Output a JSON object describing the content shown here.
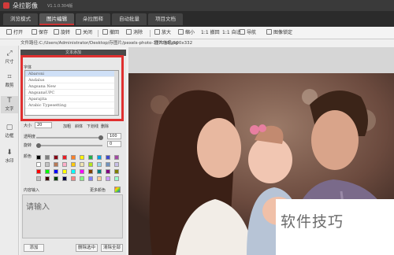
{
  "window": {
    "title": "朵拉影像",
    "version": "V1.1.0.304版"
  },
  "tabs": [
    {
      "label": "浏览模式",
      "active": false
    },
    {
      "label": "图片编辑",
      "active": true
    },
    {
      "label": "朵拉图释",
      "active": false
    },
    {
      "label": "自动批量",
      "active": false
    },
    {
      "label": "项目文档",
      "active": false
    }
  ],
  "toolbar": {
    "open": "打开",
    "save": "保存",
    "rotate": "旋转",
    "close": "关闭",
    "flip": "撤回",
    "redo": "消除",
    "zoom_in": "放大",
    "zoom_out": "缩小",
    "ratio": "1:1 撤回",
    "fit": "1:1 自适",
    "nav": "导航",
    "lock": "图像锁定"
  },
  "path": {
    "label": "文件路径:C:/Users/Administrator/Desktop/存图片/pexels-photo-377058.jpg",
    "size": "图片信息:500x332"
  },
  "left_tools": [
    "尺寸",
    "裁剪",
    "文字",
    "边框",
    "水印"
  ],
  "panel": {
    "header": "文本添加",
    "font_label": "字体",
    "fonts": [
      "Abaroni",
      "Andalus",
      "Angsana New",
      "AngsanaUPC",
      "Aparajita",
      "Arabic Typesetting"
    ],
    "size_label": "大小",
    "size_value": "20",
    "bold": "加粗",
    "italic": "斜体",
    "underline": "下划线",
    "strike": "删除",
    "opacity_label": "透明度",
    "opacity_value": "100",
    "rotate_label": "旋转",
    "rotate_value": "0",
    "color_label": "颜色",
    "content_label": "内容输入",
    "more_colors": "更多颜色",
    "placeholder": "请输入",
    "add": "添加",
    "delete_selected": "删除选中",
    "delete_all": "清除全部"
  },
  "colors": {
    "accent": "#e03030",
    "swatches": [
      "#000000",
      "#7f7f7f",
      "#880015",
      "#ed1c24",
      "#ff7f27",
      "#fff200",
      "#22b14c",
      "#00a2e8",
      "#3f48cc",
      "#a349a4",
      "#ffffff",
      "#c3c3c3",
      "#b97a57",
      "#ffaec9",
      "#ffc90e",
      "#efe4b0",
      "#b5e61d",
      "#99d9ea",
      "#7092be",
      "#c8bfe7",
      "#ff0000",
      "#00ff00",
      "#0000ff",
      "#ffff00",
      "#00ffff",
      "#ff00ff",
      "#804000",
      "#008080",
      "#800080",
      "#808000",
      "#c0c0c0",
      "#400000",
      "#004000",
      "#000040",
      "#ff8080",
      "#80ff80",
      "#8080ff",
      "#ffcc99",
      "#cc99ff",
      "#99ffcc"
    ]
  },
  "watermark": "软件技巧"
}
